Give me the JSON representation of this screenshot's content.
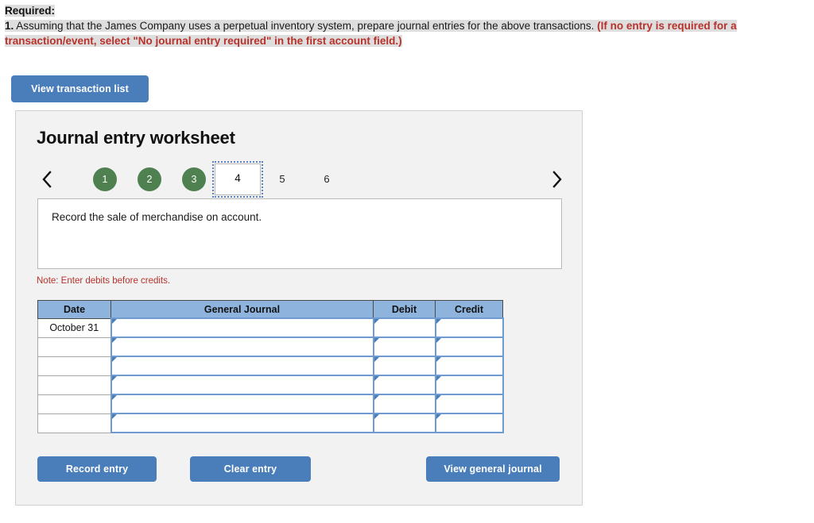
{
  "prompt": {
    "required_label": "Required:",
    "number": "1.",
    "body": " Assuming that the James Company uses a perpetual inventory system, prepare journal entries for the above transactions. ",
    "red_note": "(If no entry is required for a transaction/event, select \"No journal entry required\" in the first account field.)",
    "highlight_color": "#dedede",
    "red_color": "#b8322b"
  },
  "toolbar": {
    "view_transaction_list_label": "View transaction list"
  },
  "worksheet": {
    "title": "Journal entry worksheet",
    "prev_icon": "chevron-left-icon",
    "next_icon": "chevron-right-icon",
    "steps": [
      {
        "label": "1",
        "state": "completed"
      },
      {
        "label": "2",
        "state": "completed"
      },
      {
        "label": "3",
        "state": "completed"
      },
      {
        "label": "4",
        "state": "current"
      },
      {
        "label": "5",
        "state": "pending"
      },
      {
        "label": "6",
        "state": "pending"
      }
    ],
    "completed_color": "#4f8050",
    "current_outline_color": "#5b84c4",
    "description": "Record the sale of merchandise on account.",
    "note": "Note: Enter debits before credits."
  },
  "table": {
    "headers": [
      "Date",
      "General Journal",
      "Debit",
      "Credit"
    ],
    "header_bg": "#8eb4de",
    "rows": [
      {
        "date": "October 31",
        "general_journal": "",
        "debit": "",
        "credit": ""
      },
      {
        "date": "",
        "general_journal": "",
        "debit": "",
        "credit": ""
      },
      {
        "date": "",
        "general_journal": "",
        "debit": "",
        "credit": ""
      },
      {
        "date": "",
        "general_journal": "",
        "debit": "",
        "credit": ""
      },
      {
        "date": "",
        "general_journal": "",
        "debit": "",
        "credit": ""
      },
      {
        "date": "",
        "general_journal": "",
        "debit": "",
        "credit": ""
      }
    ]
  },
  "footer": {
    "record_entry_label": "Record entry",
    "clear_entry_label": "Clear entry",
    "view_general_journal_label": "View general journal",
    "button_color": "#4a7ebb"
  }
}
